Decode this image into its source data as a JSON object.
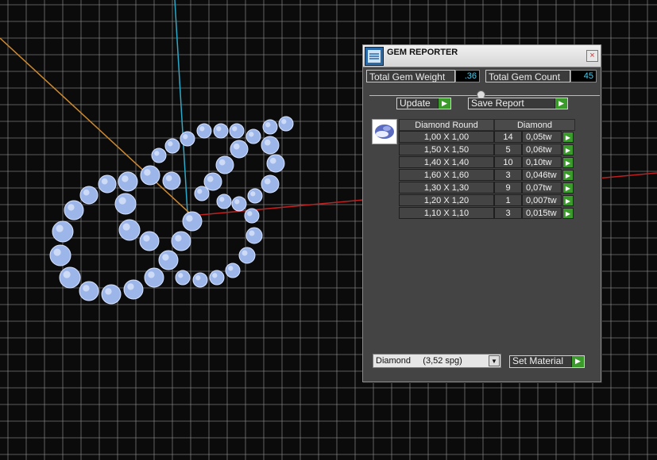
{
  "window": {
    "title": "GEM REPORTER",
    "close_glyph": "×"
  },
  "summary": {
    "weight_label": "Total Gem Weight",
    "weight_value": ".36",
    "count_label": "Total Gem Count",
    "count_value": "45"
  },
  "toolbar": {
    "update_label": "Update",
    "save_label": "Save Report",
    "arrow_glyph": "▶"
  },
  "table": {
    "headers": [
      "Diamond Round",
      "Diamond"
    ],
    "rows": [
      {
        "size": "1,00 X 1,00",
        "count": "14",
        "weight": "0,05tw"
      },
      {
        "size": "1,50 X 1,50",
        "count": "5",
        "weight": "0,06tw"
      },
      {
        "size": "1,40 X 1,40",
        "count": "10",
        "weight": "0,10tw"
      },
      {
        "size": "1,60 X 1,60",
        "count": "3",
        "weight": "0,046tw"
      },
      {
        "size": "1,30 X 1,30",
        "count": "9",
        "weight": "0,07tw"
      },
      {
        "size": "1,20 X 1,20",
        "count": "1",
        "weight": "0,007tw"
      },
      {
        "size": "1,10 X 1,10",
        "count": "3",
        "weight": "0,015tw"
      }
    ]
  },
  "material": {
    "selected": "Diamond     (3,52 spg)",
    "set_label": "Set Material"
  },
  "icons": {
    "app": "gem-reporter-app-icon",
    "material": "diamond-material-icon",
    "close": "close-icon"
  },
  "colors": {
    "grid": "#9a9a9a",
    "x_axis": "#c02020",
    "y_axis": "#2aa9c9",
    "z_axis": "#d08b30",
    "gem": "#9db6ea",
    "value_text": "#4ec9e8",
    "arrow_button": "#3a9a2a"
  }
}
